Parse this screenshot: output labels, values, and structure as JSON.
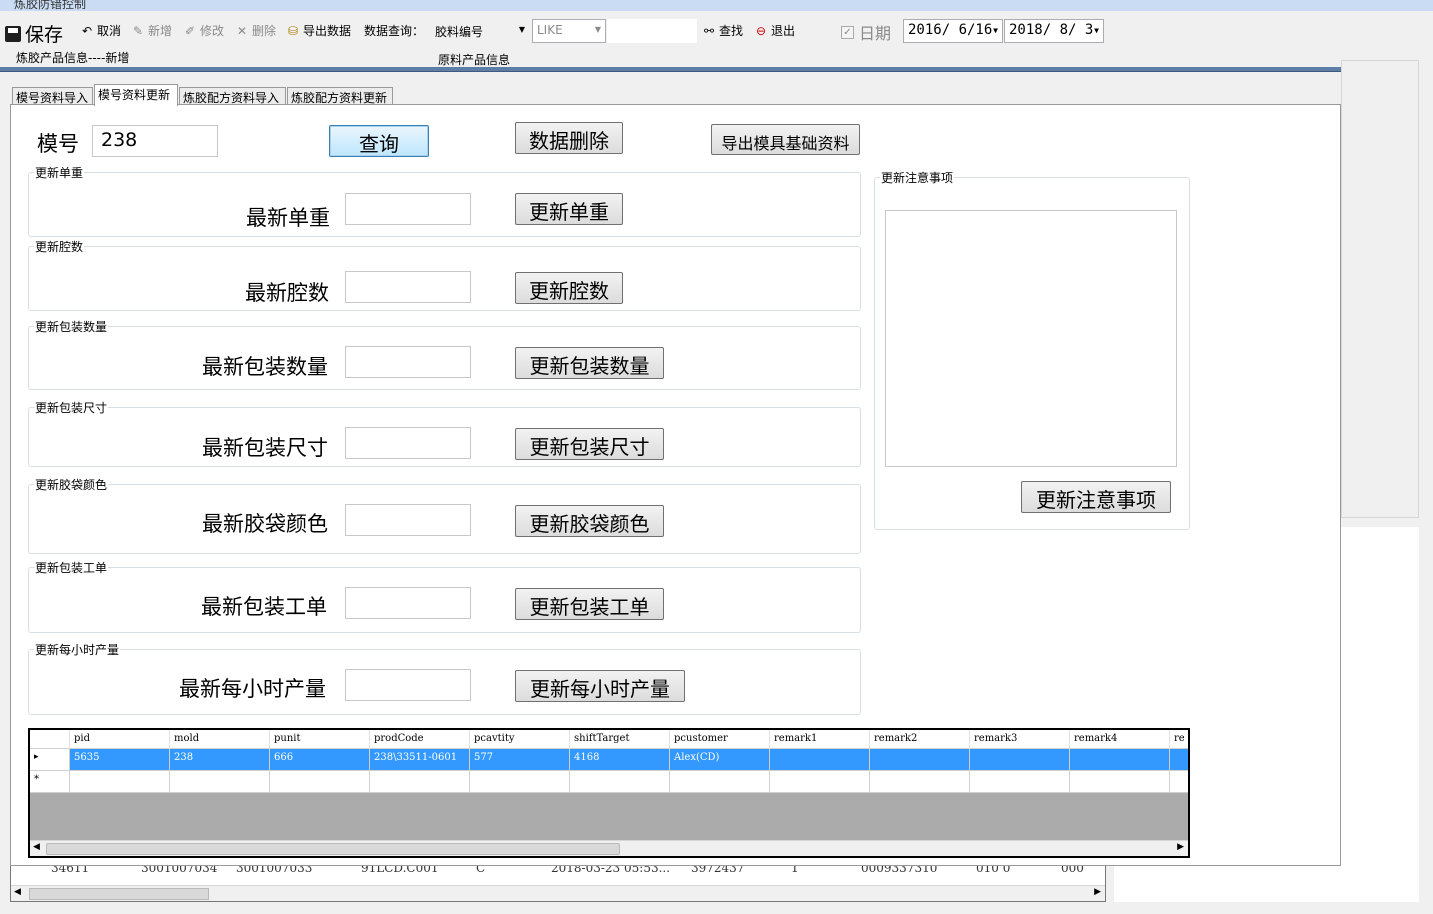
{
  "window": {
    "title": "炼胶防错控制"
  },
  "toolbar": {
    "save": "保存",
    "cancel": "取消",
    "add": "新增",
    "edit": "修改",
    "delete": "删除",
    "export": "导出数据",
    "query_label": "数据查询：",
    "field_select": "胶料编号",
    "operator_select": "LIKE",
    "query_value": "",
    "find": "查找",
    "exit": "退出",
    "date_label": "日期",
    "date_checked": true,
    "date_from": "2016/ 6/16",
    "date_to": "2018/ 8/ 3"
  },
  "sections": {
    "product_info": "炼胶产品信息----新增",
    "raw_info": "原料产品信息"
  },
  "tabs": [
    {
      "label": "模号资料导入",
      "active": false
    },
    {
      "label": "模号资料更新",
      "active": true
    },
    {
      "label": "炼胶配方资料导入",
      "active": false
    },
    {
      "label": "炼胶配方资料更新",
      "active": false
    }
  ],
  "form": {
    "mold_label": "模号",
    "mold_value": "238",
    "query_button": "查询",
    "delete_button": "数据删除",
    "export_button": "导出模具基础资料",
    "groups": [
      {
        "title": "更新单重",
        "label": "最新单重",
        "button": "更新单重"
      },
      {
        "title": "更新腔数",
        "label": "最新腔数",
        "button": "更新腔数"
      },
      {
        "title": "更新包装数量",
        "label": "最新包装数量",
        "button": "更新包装数量"
      },
      {
        "title": "更新包装尺寸",
        "label": "最新包装尺寸",
        "button": "更新包装尺寸"
      },
      {
        "title": "更新胶袋颜色",
        "label": "最新胶袋颜色",
        "button": "更新胶袋颜色"
      },
      {
        "title": "更新包装工单",
        "label": "最新包装工单",
        "button": "更新包装工单"
      },
      {
        "title": "更新每小时产量",
        "label": "最新每小时产量",
        "button": "更新每小时产量"
      }
    ],
    "notes_title": "更新注意事项",
    "notes_value": "",
    "notes_button": "更新注意事项"
  },
  "grid": {
    "columns": [
      "pid",
      "mold",
      "punit",
      "prodCode",
      "pcavtity",
      "shiftTarget",
      "pcustomer",
      "remark1",
      "remark2",
      "remark3",
      "remark4",
      "re"
    ],
    "rows": [
      [
        "5635",
        "238",
        "666",
        "238\\33511-0601",
        "577",
        "4168",
        "Alex(CD)",
        "",
        "",
        "",
        "",
        ""
      ]
    ],
    "new_row_marker": "*",
    "current_row_marker": "▸"
  },
  "background_grid": {
    "row": [
      "34611",
      "3001007034",
      "3001007033",
      "91LCD.C001",
      "C",
      "2018-03-23 05:53...",
      "3972437",
      "1",
      "0009337310",
      "010 0",
      "000"
    ]
  }
}
